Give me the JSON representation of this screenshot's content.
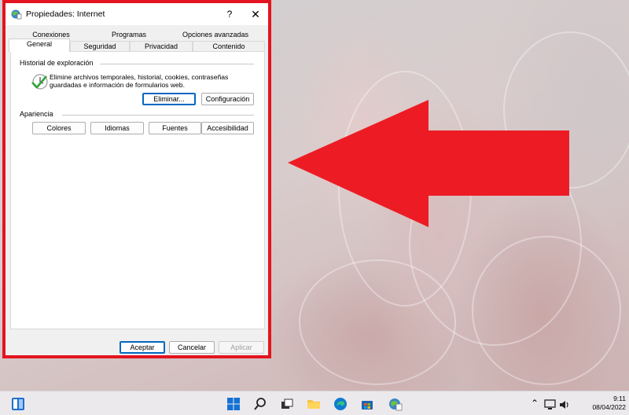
{
  "window": {
    "title": "Propiedades: Internet",
    "help_label": "?",
    "close_label": "✕"
  },
  "tabs_row1": [
    "Conexiones",
    "Programas",
    "Opciones avanzadas"
  ],
  "tabs_row2": [
    "General",
    "Seguridad",
    "Privacidad",
    "Contenido"
  ],
  "active_tab": "General",
  "browsing_history": {
    "heading": "Historial de exploración",
    "description": "Elimine archivos temporales, historial, cookies, contraseñas guardadas e información de formularios web.",
    "delete_label": "Eliminar...",
    "settings_label": "Configuración"
  },
  "appearance": {
    "heading": "Apariencia",
    "colors_label": "Colores",
    "languages_label": "Idiomas",
    "fonts_label": "Fuentes",
    "accessibility_label": "Accesibilidad"
  },
  "footer": {
    "ok_label": "Aceptar",
    "cancel_label": "Cancelar",
    "apply_label": "Aplicar"
  },
  "taskbar": {
    "time": "9:11",
    "date": "08/04/2022"
  },
  "colors": {
    "frame_highlight": "#e3141f",
    "arrow": "#ed1c24",
    "accent": "#0067c0"
  }
}
